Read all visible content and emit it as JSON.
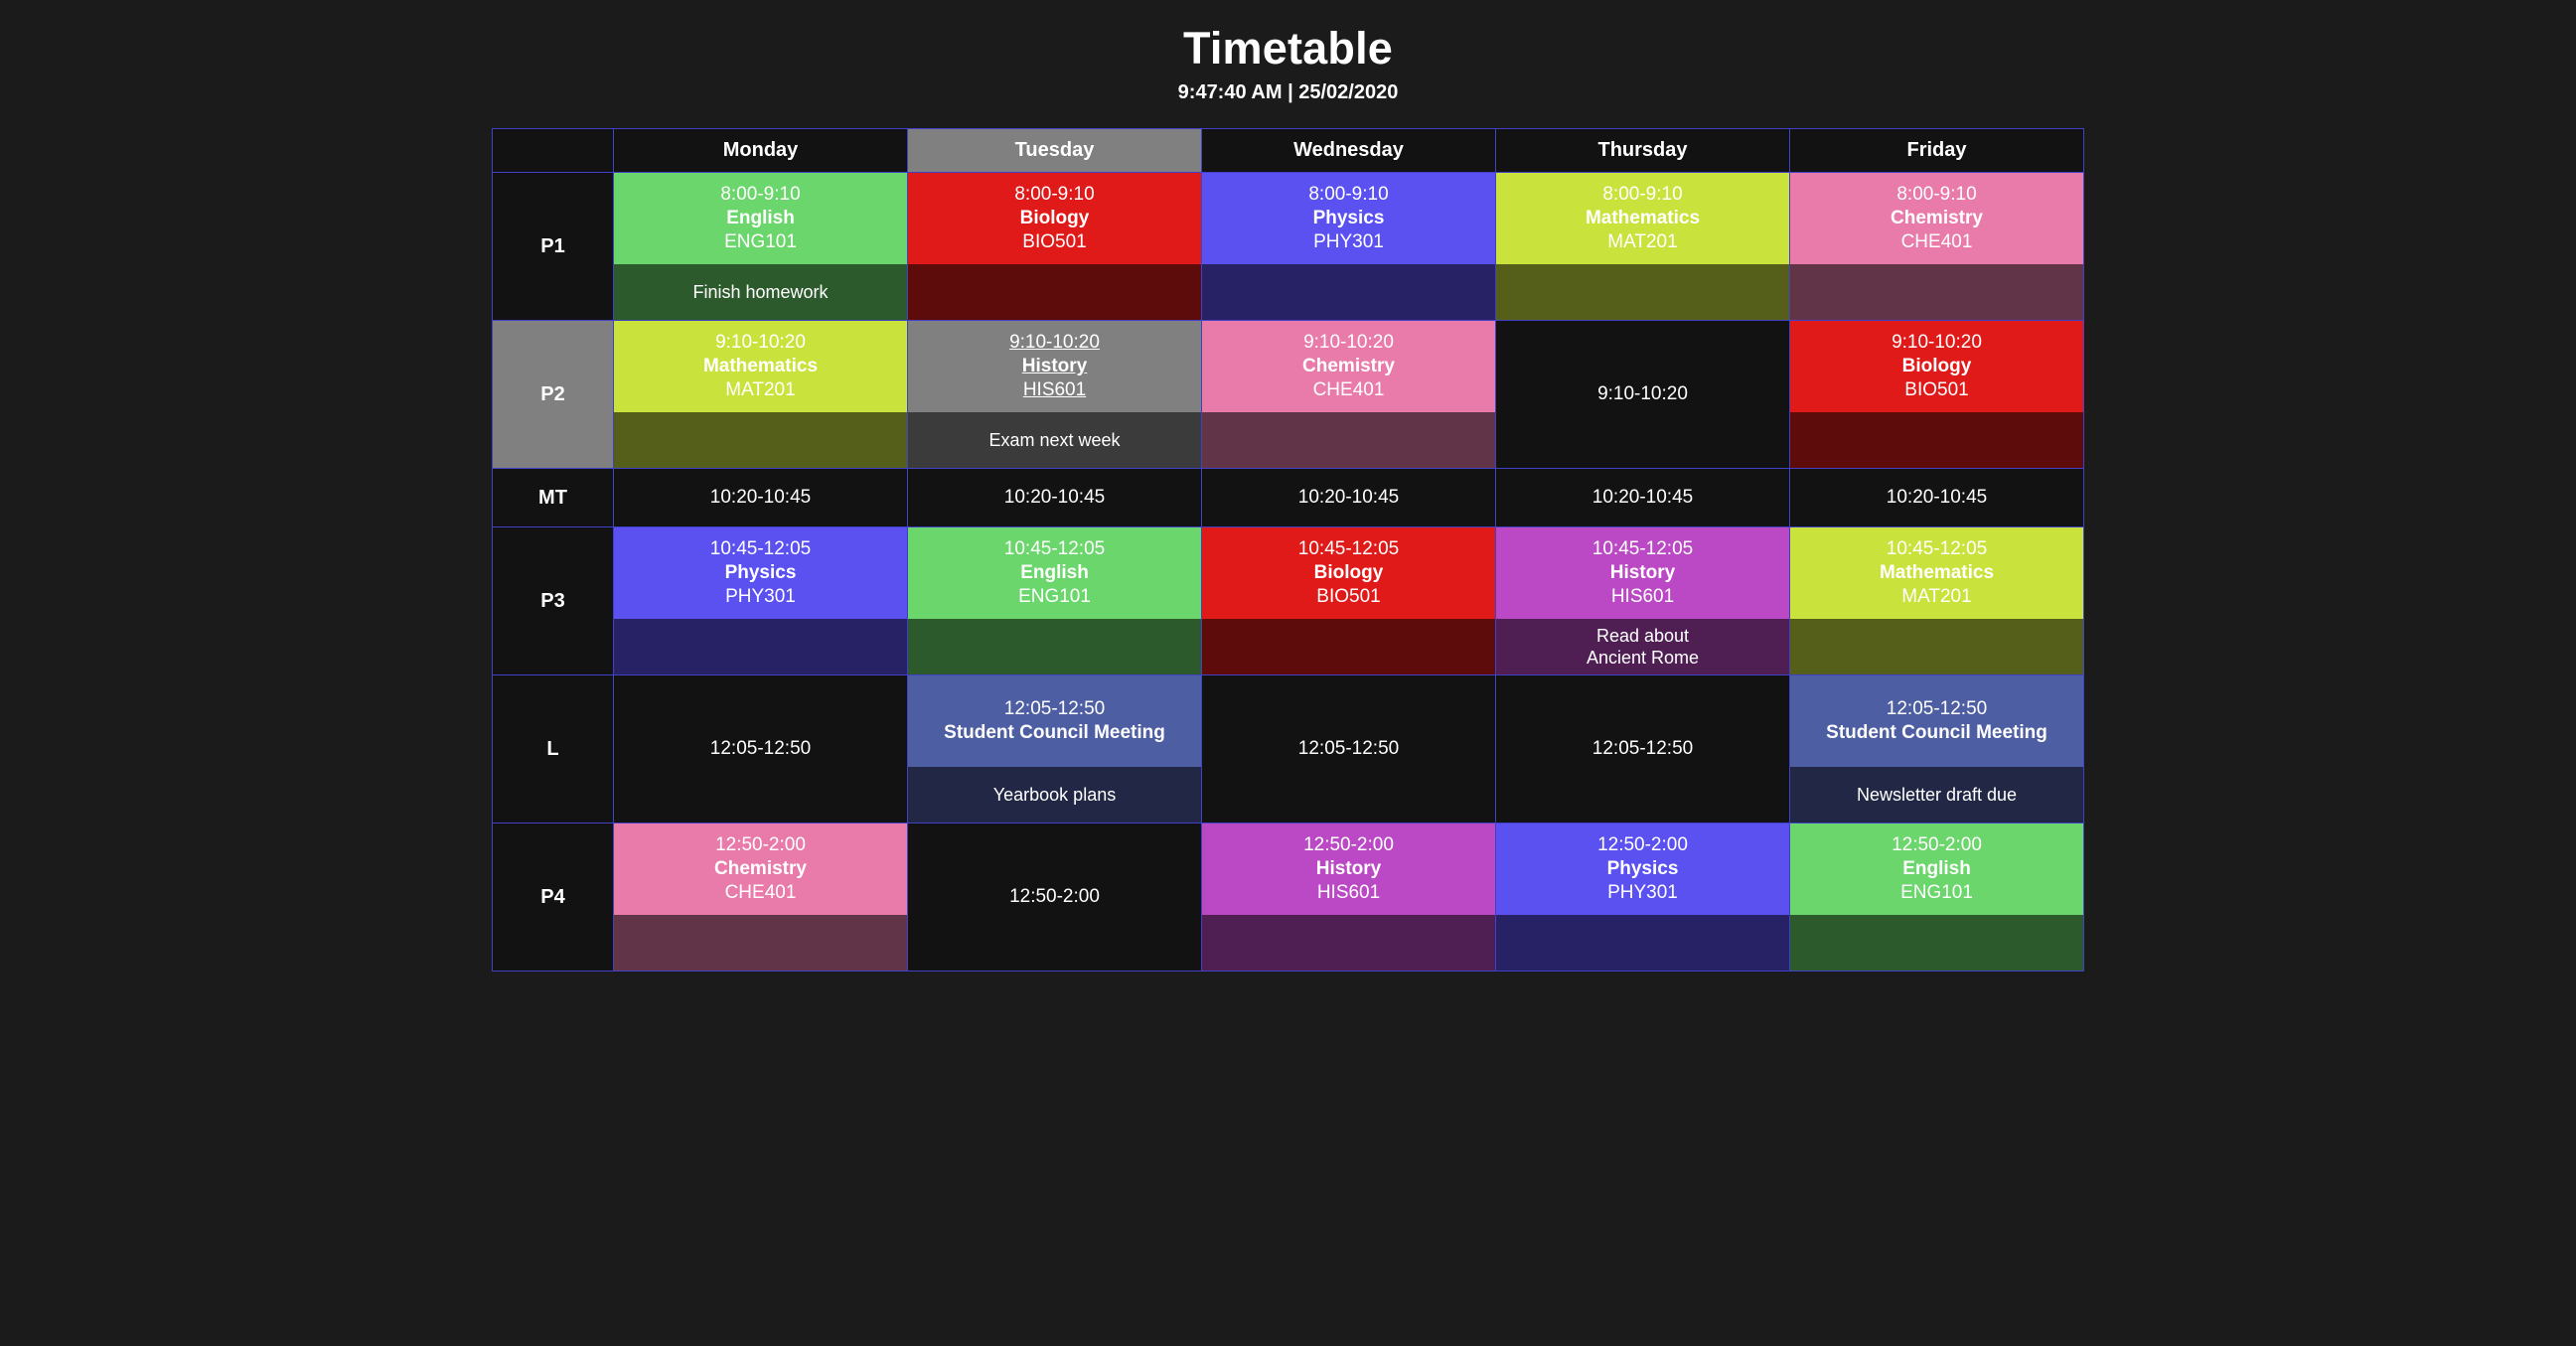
{
  "header": {
    "title": "Timetable",
    "clock": "9:47:40 AM | 25/02/2020"
  },
  "table": {
    "corner_label": "",
    "days": [
      "Monday",
      "Tuesday",
      "Wednesday",
      "Thursday",
      "Friday"
    ],
    "today": "Tuesday",
    "current_period": "P2"
  },
  "colors": {
    "page_background": "#1b1b1b",
    "cell_background": "#121212",
    "grid_border": "#4140c8",
    "highlight_gray": "#808080",
    "english": "#6bd66b",
    "biology": "#e01919",
    "physics": "#5b51f0",
    "mathematics": "#cae33c",
    "chemistry": "#e87baa",
    "history": "#bb49c6",
    "student_council": "#4e5ea3",
    "current_slot": "#808080"
  },
  "rows": [
    {
      "period": "P1",
      "kind": "lesson",
      "cells": [
        {
          "time": "8:00-9:10",
          "subject": "English",
          "code": "ENG101",
          "color": "#6bd66b",
          "note": "Finish homework"
        },
        {
          "time": "8:00-9:10",
          "subject": "Biology",
          "code": "BIO501",
          "color": "#e01919",
          "note": ""
        },
        {
          "time": "8:00-9:10",
          "subject": "Physics",
          "code": "PHY301",
          "color": "#5b51f0",
          "note": ""
        },
        {
          "time": "8:00-9:10",
          "subject": "Mathematics",
          "code": "MAT201",
          "color": "#cae33c",
          "note": ""
        },
        {
          "time": "8:00-9:10",
          "subject": "Chemistry",
          "code": "CHE401",
          "color": "#e87baa",
          "note": ""
        }
      ]
    },
    {
      "period": "P2",
      "kind": "lesson",
      "current": true,
      "cells": [
        {
          "time": "9:10-10:20",
          "subject": "Mathematics",
          "code": "MAT201",
          "color": "#cae33c",
          "note": ""
        },
        {
          "time": "9:10-10:20",
          "subject": "History",
          "code": "HIS601",
          "color": "#808080",
          "note": "Exam next week",
          "current": true
        },
        {
          "time": "9:10-10:20",
          "subject": "Chemistry",
          "code": "CHE401",
          "color": "#e87baa",
          "note": ""
        },
        {
          "time": "9:10-10:20",
          "subject": "",
          "code": "",
          "color": "",
          "note": "",
          "empty": true
        },
        {
          "time": "9:10-10:20",
          "subject": "Biology",
          "code": "BIO501",
          "color": "#e01919",
          "note": ""
        }
      ]
    },
    {
      "period": "MT",
      "kind": "break",
      "cells": [
        {
          "time": "10:20-10:45",
          "empty": true
        },
        {
          "time": "10:20-10:45",
          "empty": true
        },
        {
          "time": "10:20-10:45",
          "empty": true
        },
        {
          "time": "10:20-10:45",
          "empty": true
        },
        {
          "time": "10:20-10:45",
          "empty": true
        }
      ]
    },
    {
      "period": "P3",
      "kind": "lesson",
      "cells": [
        {
          "time": "10:45-12:05",
          "subject": "Physics",
          "code": "PHY301",
          "color": "#5b51f0",
          "note": ""
        },
        {
          "time": "10:45-12:05",
          "subject": "English",
          "code": "ENG101",
          "color": "#6bd66b",
          "note": ""
        },
        {
          "time": "10:45-12:05",
          "subject": "Biology",
          "code": "BIO501",
          "color": "#e01919",
          "note": ""
        },
        {
          "time": "10:45-12:05",
          "subject": "History",
          "code": "HIS601",
          "color": "#bb49c6",
          "note": "Read about\nAncient Rome"
        },
        {
          "time": "10:45-12:05",
          "subject": "Mathematics",
          "code": "MAT201",
          "color": "#cae33c",
          "note": ""
        }
      ]
    },
    {
      "period": "L",
      "kind": "lesson",
      "cells": [
        {
          "time": "12:05-12:50",
          "subject": "",
          "code": "",
          "color": "",
          "note": "",
          "empty": true
        },
        {
          "time": "12:05-12:50",
          "subject": "Student Council Meeting",
          "code": "",
          "color": "#4e5ea3",
          "note": "Yearbook plans"
        },
        {
          "time": "12:05-12:50",
          "subject": "",
          "code": "",
          "color": "",
          "note": "",
          "empty": true
        },
        {
          "time": "12:05-12:50",
          "subject": "",
          "code": "",
          "color": "",
          "note": "",
          "empty": true
        },
        {
          "time": "12:05-12:50",
          "subject": "Student Council Meeting",
          "code": "",
          "color": "#4e5ea3",
          "note": "Newsletter draft due"
        }
      ]
    },
    {
      "period": "P4",
      "kind": "lesson",
      "cells": [
        {
          "time": "12:50-2:00",
          "subject": "Chemistry",
          "code": "CHE401",
          "color": "#e87baa",
          "note": ""
        },
        {
          "time": "12:50-2:00",
          "subject": "",
          "code": "",
          "color": "",
          "note": "",
          "empty": true
        },
        {
          "time": "12:50-2:00",
          "subject": "History",
          "code": "HIS601",
          "color": "#bb49c6",
          "note": ""
        },
        {
          "time": "12:50-2:00",
          "subject": "Physics",
          "code": "PHY301",
          "color": "#5b51f0",
          "note": ""
        },
        {
          "time": "12:50-2:00",
          "subject": "English",
          "code": "ENG101",
          "color": "#6bd66b",
          "note": ""
        }
      ]
    }
  ]
}
